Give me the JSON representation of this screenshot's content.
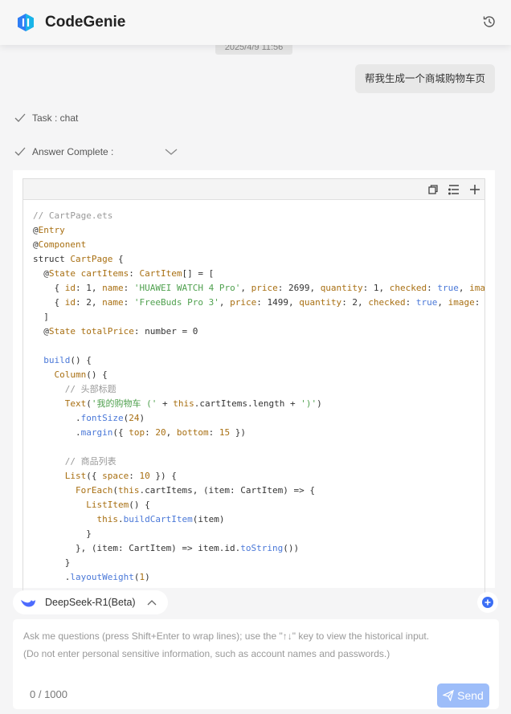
{
  "header": {
    "brand": "CodeGenie",
    "history_icon": "history-icon"
  },
  "chat": {
    "timestamp": "2025/4/9 11:56",
    "user_message": "帮我生成一个商城购物车页",
    "task_label": "Task :  chat",
    "answer_label": "Answer Complete :"
  },
  "code_block": {
    "toolbar_icons": [
      "copy-icon",
      "wrap-lines-icon",
      "insert-icon"
    ],
    "lines": [
      [
        [
          "// CartPage.ets",
          "c"
        ]
      ],
      [
        [
          "@",
          ""
        ],
        [
          "Entry",
          "o"
        ]
      ],
      [
        [
          "@",
          ""
        ],
        [
          "Component",
          "o"
        ]
      ],
      [
        [
          "struct ",
          ""
        ],
        [
          "CartPage",
          "o"
        ],
        [
          " {",
          ""
        ]
      ],
      [
        [
          "  @",
          ""
        ],
        [
          "State",
          "o"
        ],
        [
          " ",
          ""
        ],
        [
          "cartItems",
          "o"
        ],
        [
          ": ",
          ""
        ],
        [
          "CartItem",
          "o"
        ],
        [
          "[] = [",
          ""
        ]
      ],
      [
        [
          "    { ",
          ""
        ],
        [
          "id",
          "o"
        ],
        [
          ": 1, ",
          ""
        ],
        [
          "name",
          "o"
        ],
        [
          ": ",
          ""
        ],
        [
          "'HUAWEI WATCH 4 Pro'",
          "s"
        ],
        [
          ", ",
          ""
        ],
        [
          "price",
          "o"
        ],
        [
          ": 2699, ",
          ""
        ],
        [
          "quantity",
          "o"
        ],
        [
          ": 1, ",
          ""
        ],
        [
          "checked",
          "o"
        ],
        [
          ": ",
          ""
        ],
        [
          "true",
          "b"
        ],
        [
          ", ",
          ""
        ],
        [
          "ima",
          "o"
        ]
      ],
      [
        [
          "    { ",
          ""
        ],
        [
          "id",
          "o"
        ],
        [
          ": 2, ",
          ""
        ],
        [
          "name",
          "o"
        ],
        [
          ": ",
          ""
        ],
        [
          "'FreeBuds Pro 3'",
          "s"
        ],
        [
          ", ",
          ""
        ],
        [
          "price",
          "o"
        ],
        [
          ": 1499, ",
          ""
        ],
        [
          "quantity",
          "o"
        ],
        [
          ": 2, ",
          ""
        ],
        [
          "checked",
          "o"
        ],
        [
          ": ",
          ""
        ],
        [
          "true",
          "b"
        ],
        [
          ", ",
          ""
        ],
        [
          "image",
          "o"
        ],
        [
          ":",
          ""
        ]
      ],
      [
        [
          "  ]",
          ""
        ]
      ],
      [
        [
          "  @",
          ""
        ],
        [
          "State",
          "o"
        ],
        [
          " ",
          ""
        ],
        [
          "totalPrice",
          "o"
        ],
        [
          ": number = 0",
          ""
        ]
      ],
      [
        [
          "",
          ""
        ]
      ],
      [
        [
          "  ",
          ""
        ],
        [
          "build",
          "b"
        ],
        [
          "() {",
          ""
        ]
      ],
      [
        [
          "    ",
          ""
        ],
        [
          "Column",
          "o"
        ],
        [
          "() {",
          ""
        ]
      ],
      [
        [
          "      // 头部标题",
          "c"
        ]
      ],
      [
        [
          "      ",
          ""
        ],
        [
          "Text",
          "o"
        ],
        [
          "(",
          ""
        ],
        [
          "'我的购物车 ('",
          "s"
        ],
        [
          " + ",
          ""
        ],
        [
          "this",
          "o"
        ],
        [
          ".cartItems.length + ",
          ""
        ],
        [
          "')'",
          "s"
        ],
        [
          ")",
          ""
        ]
      ],
      [
        [
          "        .",
          ""
        ],
        [
          "fontSize",
          "b"
        ],
        [
          "(",
          ""
        ],
        [
          "24",
          "o"
        ],
        [
          ")",
          ""
        ]
      ],
      [
        [
          "        .",
          ""
        ],
        [
          "margin",
          "b"
        ],
        [
          "({ ",
          ""
        ],
        [
          "top",
          "o"
        ],
        [
          ": ",
          ""
        ],
        [
          "20",
          "o"
        ],
        [
          ", ",
          ""
        ],
        [
          "bottom",
          "o"
        ],
        [
          ": ",
          ""
        ],
        [
          "15",
          "o"
        ],
        [
          " })",
          ""
        ]
      ],
      [
        [
          "",
          ""
        ]
      ],
      [
        [
          "      // 商品列表",
          "c"
        ]
      ],
      [
        [
          "      ",
          ""
        ],
        [
          "List",
          "o"
        ],
        [
          "({ ",
          ""
        ],
        [
          "space",
          "o"
        ],
        [
          ": ",
          ""
        ],
        [
          "10",
          "o"
        ],
        [
          " }) {",
          ""
        ]
      ],
      [
        [
          "        ",
          ""
        ],
        [
          "ForEach",
          "o"
        ],
        [
          "(",
          ""
        ],
        [
          "this",
          "o"
        ],
        [
          ".cartItems, (item: CartItem) => {",
          ""
        ]
      ],
      [
        [
          "          ",
          ""
        ],
        [
          "ListItem",
          "o"
        ],
        [
          "() {",
          ""
        ]
      ],
      [
        [
          "            ",
          ""
        ],
        [
          "this",
          "o"
        ],
        [
          ".",
          ""
        ],
        [
          "buildCartItem",
          "b"
        ],
        [
          "(item)",
          ""
        ]
      ],
      [
        [
          "          }",
          ""
        ]
      ],
      [
        [
          "        }, (item: CartItem) => item.id.",
          ""
        ],
        [
          "toString",
          "b"
        ],
        [
          "())",
          ""
        ]
      ],
      [
        [
          "      }",
          ""
        ]
      ],
      [
        [
          "      .",
          ""
        ],
        [
          "layoutWeight",
          "b"
        ],
        [
          "(",
          ""
        ],
        [
          "1",
          "o"
        ],
        [
          ")",
          ""
        ]
      ]
    ]
  },
  "model_selector": {
    "label": "DeepSeek-R1(Beta)",
    "icon": "deepseek-whale-icon"
  },
  "input": {
    "placeholder_line1": "Ask me questions (press Shift+Enter to wrap lines); use the \"↑↓\" key to view the historical input.",
    "placeholder_line2": "(Do not enter personal sensitive information, such as account names and passwords.)",
    "counter": "0 / 1000",
    "send_label": "Send"
  }
}
